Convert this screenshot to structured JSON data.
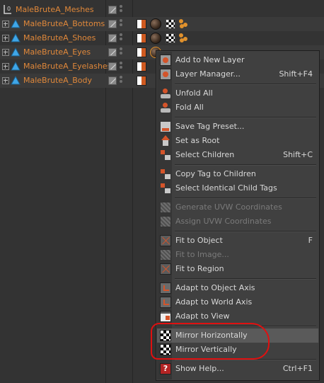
{
  "tree": {
    "root": {
      "name": "MaleBruteA_Meshes"
    },
    "children": [
      {
        "name": "MaleBruteA_Bottoms"
      },
      {
        "name": "MaleBruteA_Shoes"
      },
      {
        "name": "MaleBruteA_Eyes"
      },
      {
        "name": "MaleBruteA_Eyelashes"
      },
      {
        "name": "MaleBruteA_Body"
      }
    ],
    "root_icon": "null-object-icon",
    "child_icon": "polygon-object-icon",
    "tag_icons": [
      "texture-flag-icon",
      "material-icon",
      "checker-tag-icon",
      "sphere-dots-icon"
    ]
  },
  "menu": {
    "items": [
      {
        "label": "Add to New Layer",
        "shortcut": "",
        "icon": "layer-icon",
        "enabled": true
      },
      {
        "label": "Layer Manager...",
        "shortcut": "Shift+F4",
        "icon": "layer-manager-icon",
        "enabled": true
      },
      {
        "label": "Unfold All",
        "shortcut": "",
        "icon": "unfold-icon",
        "enabled": true
      },
      {
        "label": "Fold All",
        "shortcut": "",
        "icon": "fold-icon",
        "enabled": true
      },
      {
        "label": "Save Tag Preset...",
        "shortcut": "",
        "icon": "save-preset-icon",
        "enabled": true
      },
      {
        "label": "Set as Root",
        "shortcut": "",
        "icon": "root-icon",
        "enabled": true
      },
      {
        "label": "Select Children",
        "shortcut": "Shift+C",
        "icon": "children-icon",
        "enabled": true
      },
      {
        "label": "Copy Tag to Children",
        "shortcut": "",
        "icon": "copy-tag-icon",
        "enabled": true
      },
      {
        "label": "Select Identical Child Tags",
        "shortcut": "",
        "icon": "identical-tags-icon",
        "enabled": true
      },
      {
        "label": "Generate UVW Coordinates",
        "shortcut": "",
        "icon": "uvw-icon",
        "enabled": false
      },
      {
        "label": "Assign UVW Coordinates",
        "shortcut": "",
        "icon": "uvw-assign-icon",
        "enabled": false
      },
      {
        "label": "Fit to Object",
        "shortcut": "F",
        "icon": "fit-object-icon",
        "enabled": true
      },
      {
        "label": "Fit to Image...",
        "shortcut": "",
        "icon": "fit-image-icon",
        "enabled": false
      },
      {
        "label": "Fit to Region",
        "shortcut": "",
        "icon": "fit-region-icon",
        "enabled": true
      },
      {
        "label": "Adapt to Object Axis",
        "shortcut": "",
        "icon": "object-axis-icon",
        "enabled": true
      },
      {
        "label": "Adapt to World Axis",
        "shortcut": "",
        "icon": "world-axis-icon",
        "enabled": true
      },
      {
        "label": "Adapt to View",
        "shortcut": "",
        "icon": "view-icon",
        "enabled": true
      },
      {
        "label": "Mirror Horizontally",
        "shortcut": "",
        "icon": "mirror-horizontal-icon",
        "enabled": true
      },
      {
        "label": "Mirror Vertically",
        "shortcut": "",
        "icon": "mirror-vertical-icon",
        "enabled": true
      },
      {
        "label": "Show Help...",
        "shortcut": "Ctrl+F1",
        "icon": "help-icon",
        "enabled": true
      }
    ]
  },
  "colors": {
    "object_name": "#e0883a",
    "menu_text": "#d8d8d8",
    "disabled_text": "#7a7a7a",
    "annotation": "#e01010"
  }
}
